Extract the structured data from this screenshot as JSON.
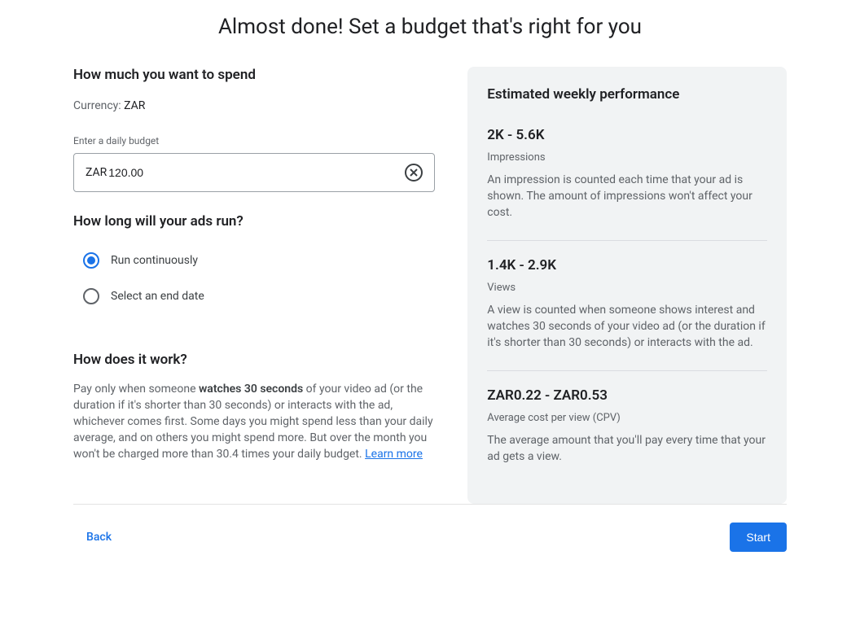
{
  "title": "Almost done! Set a budget that's right for you",
  "spend": {
    "heading": "How much you want to spend",
    "currency_label": "Currency: ",
    "currency_value": "ZAR",
    "input_label": "Enter a daily budget",
    "input_prefix": "ZAR",
    "input_value": "120.00"
  },
  "duration": {
    "heading": "How long will your ads run?",
    "option_continuous": "Run continuously",
    "option_end_date": "Select an end date"
  },
  "how": {
    "heading": "How does it work?",
    "body_pre": "Pay only when someone ",
    "body_bold": "watches 30 seconds",
    "body_post": " of your video ad (or the duration if it's shorter than 30 seconds) or interacts with the ad, whichever comes first. Some days you might spend less than your daily average, and on others you might spend more. But over the month you won't be charged more than 30.4 times your daily budget. ",
    "learn_more": "Learn more"
  },
  "estimate": {
    "heading": "Estimated weekly performance",
    "metrics": [
      {
        "value": "2K - 5.6K",
        "name": "Impressions",
        "desc": "An impression is counted each time that your ad is shown. The amount of impressions won't affect your cost."
      },
      {
        "value": "1.4K - 2.9K",
        "name": "Views",
        "desc": "A view is counted when someone shows interest and watches 30 seconds of your video ad (or the duration if it's shorter than 30 seconds) or interacts with the ad."
      },
      {
        "value": "ZAR0.22 - ZAR0.53",
        "name": "Average cost per view (CPV)",
        "desc": "The average amount that you'll pay every time that your ad gets a view."
      }
    ]
  },
  "footer": {
    "back": "Back",
    "start": "Start"
  }
}
